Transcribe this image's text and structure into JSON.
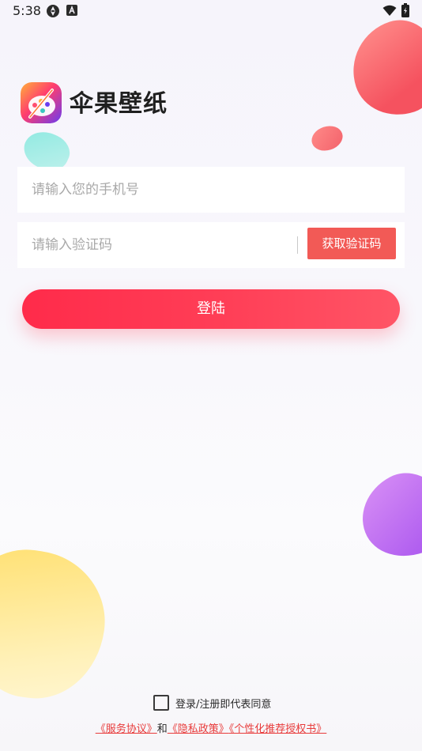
{
  "status_bar": {
    "time": "5:38"
  },
  "app": {
    "name": "伞果壁纸"
  },
  "form": {
    "phone_placeholder": "请输入您的手机号",
    "code_placeholder": "请输入验证码",
    "get_code_label": "获取验证码",
    "login_label": "登陆"
  },
  "agreement": {
    "checked": false,
    "text": "登录/注册即代表同意",
    "service_link": "《服务协议》",
    "and_text": "和",
    "privacy_link": "《隐私政策》",
    "personalized_link": "《个性化推荐授权书》"
  },
  "colors": {
    "accent": "#ff3b55",
    "code_button": "#f25a56",
    "link": "#e83b3b"
  }
}
